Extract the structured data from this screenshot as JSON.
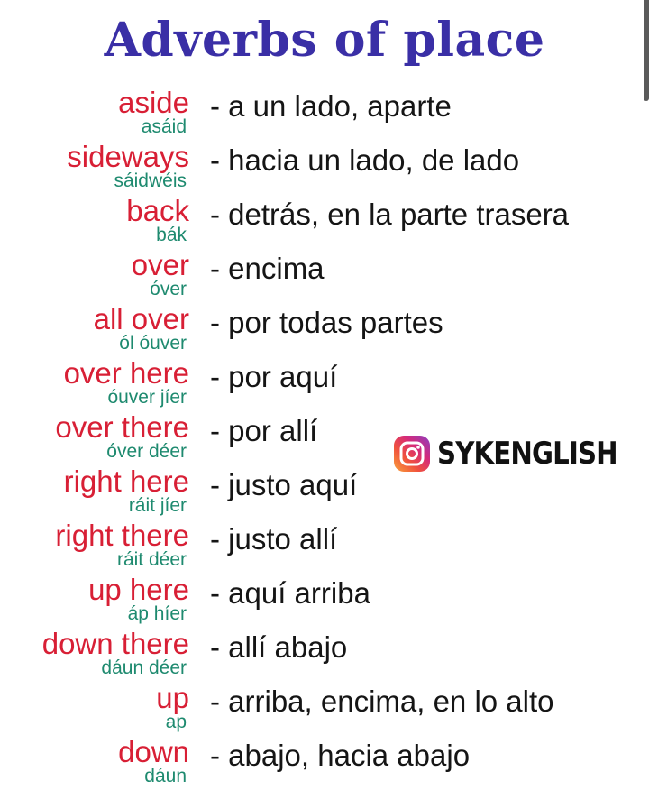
{
  "title": "Adverbs of place",
  "entries": [
    {
      "word": "aside",
      "pronunciation": "asáid",
      "translation": "- a un lado, aparte"
    },
    {
      "word": "sideways",
      "pronunciation": "sáidwéis",
      "translation": "- hacia un lado, de lado"
    },
    {
      "word": "back",
      "pronunciation": "bák",
      "translation": "- detrás, en la parte trasera"
    },
    {
      "word": "over",
      "pronunciation": "óver",
      "translation": "- encima"
    },
    {
      "word": "all over",
      "pronunciation": "ól óuver",
      "translation": "- por todas partes"
    },
    {
      "word": "over here",
      "pronunciation": "óuver jíer",
      "translation": "- por aquí"
    },
    {
      "word": "over there",
      "pronunciation": "óver déer",
      "translation": "- por allí"
    },
    {
      "word": "right here",
      "pronunciation": "ráit jíer",
      "translation": "- justo aquí"
    },
    {
      "word": "right there",
      "pronunciation": "ráit déer",
      "translation": "- justo allí"
    },
    {
      "word": "up here",
      "pronunciation": "áp híer",
      "translation": "- aquí arriba"
    },
    {
      "word": "down there",
      "pronunciation": "dáun déer",
      "translation": "- allí abajo"
    },
    {
      "word": "up",
      "pronunciation": "ap",
      "translation": "- arriba, encima, en lo alto"
    },
    {
      "word": "down",
      "pronunciation": "dáun",
      "translation": "- abajo, hacia abajo"
    }
  ],
  "brand": {
    "icon": "instagram-icon",
    "handle": "SYKENGLISH"
  },
  "colors": {
    "title": "#3a2fa6",
    "word": "#d81f35",
    "pronunciation": "#1e8a6f",
    "translation": "#151515"
  }
}
